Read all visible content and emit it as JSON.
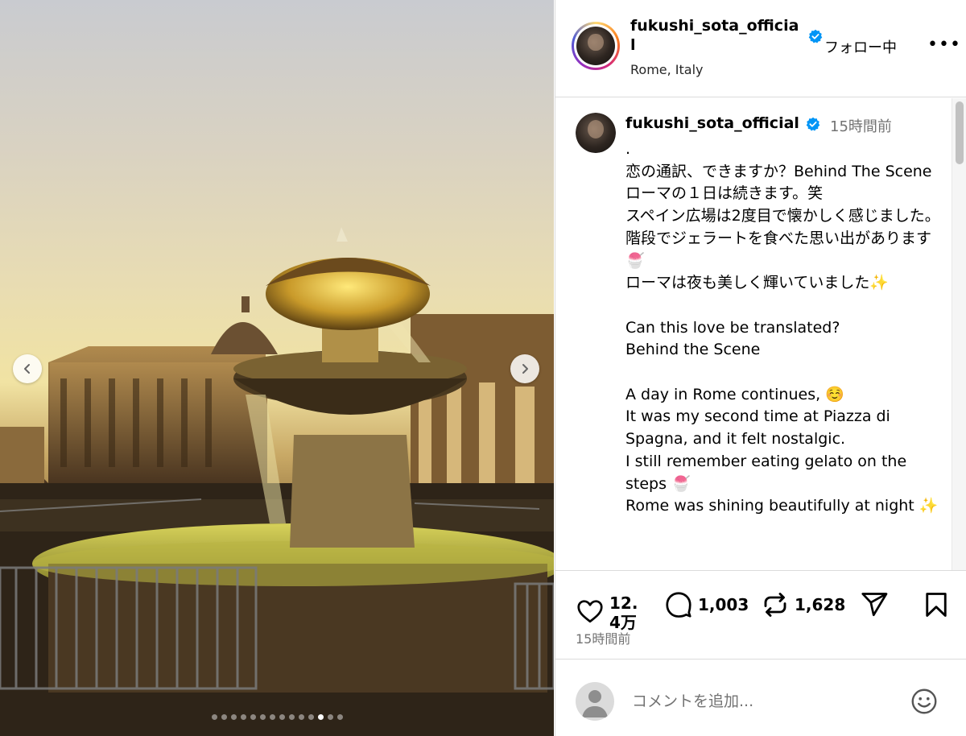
{
  "post": {
    "username": "fukushi_sota_official",
    "header_username": "fukushi_sota_officia\nl",
    "location": "Rome, Italy",
    "follow_label": "フォロー中",
    "more_label": "•••",
    "verified_icon": "verified-badge-icon",
    "caption_time": "15時間前",
    "caption": ".\n恋の通訳、できますか？Behind The Scene\nローマの１日は続きます。笑\nスペイン広場は2度目で懐かしく感じました。階段でジェラートを食べた思い出があります🍧\nローマは夜も美しく輝いていました✨\n\nCan this love be translated?\nBehind the Scene\n\nA day in Rome continues, ☺️\nIt was my second time at Piazza di Spagna, and it felt nostalgic.\nI still remember eating gelato on the steps 🍧\nRome was shining beautifully at night ✨"
  },
  "carousel": {
    "prev_icon": "chevron-left-icon",
    "next_icon": "chevron-right-icon",
    "total_slides": 14,
    "active_slide": 12
  },
  "actions": {
    "likes": "12.4万",
    "comments": "1,003",
    "reposts": "1,628",
    "post_time": "15時間前"
  },
  "comment_box": {
    "placeholder": "コメントを追加...",
    "emoji_icon": "emoji-icon"
  },
  "colors": {
    "verified_blue": "#0095f6",
    "muted_text": "#737373",
    "border": "#dbdbdb"
  }
}
